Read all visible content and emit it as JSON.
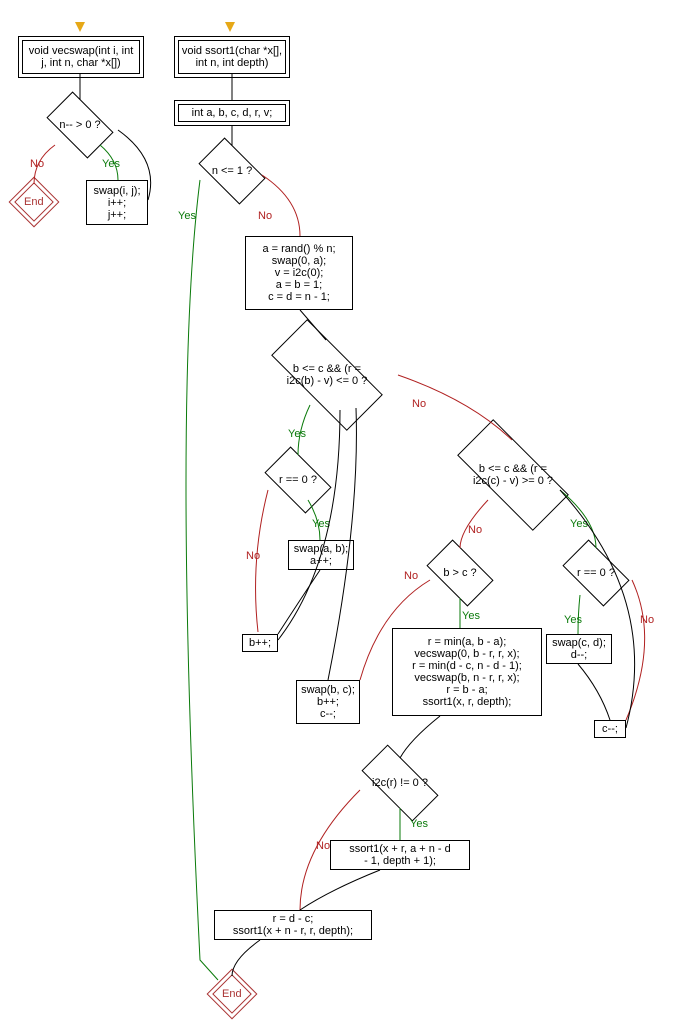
{
  "chart_data": {
    "type": "flowchart",
    "functions": [
      {
        "name": "vecswap",
        "signature": "void vecswap(int i, int j, int n, char *x[])",
        "entry": "vecswap-start",
        "nodes": [
          {
            "id": "vecswap-start",
            "kind": "start",
            "text": "void vecswap(int i, int\nj, int n, char *x[])"
          },
          {
            "id": "vec-cond",
            "kind": "decision",
            "text": "n-- > 0 ?"
          },
          {
            "id": "vec-body",
            "kind": "process",
            "text": "swap(i, j);\ni++;\nj++;"
          },
          {
            "id": "vec-end",
            "kind": "end",
            "text": "End"
          }
        ],
        "edges": [
          {
            "from": "vecswap-start",
            "to": "vec-cond"
          },
          {
            "from": "vec-cond",
            "to": "vec-body",
            "label": "Yes"
          },
          {
            "from": "vec-body",
            "to": "vec-cond",
            "back": true
          },
          {
            "from": "vec-cond",
            "to": "vec-end",
            "label": "No"
          }
        ]
      },
      {
        "name": "ssort1",
        "signature": "void ssort1(char *x[], int n, int depth)",
        "entry": "ssort1-start",
        "nodes": [
          {
            "id": "ssort1-start",
            "kind": "start",
            "text": "void ssort1(char *x[],\nint n, int depth)"
          },
          {
            "id": "decl",
            "kind": "process",
            "text": "int a, b, c, d, r, v;"
          },
          {
            "id": "n-le-1",
            "kind": "decision",
            "text": "n <= 1 ?"
          },
          {
            "id": "init",
            "kind": "process",
            "text": "a = rand() % n;\nswap(0, a);\nv = i2c(0);\na = b = 1;\nc = d = n - 1;"
          },
          {
            "id": "left-cond",
            "kind": "decision",
            "text": "b <= c && (r =\ni2c(b) - v) <= 0 ?"
          },
          {
            "id": "r-eq-0-l",
            "kind": "decision",
            "text": "r == 0 ?"
          },
          {
            "id": "swap-ab",
            "kind": "process",
            "text": "swap(a, b);\na++;"
          },
          {
            "id": "bpp",
            "kind": "process",
            "text": "b++;"
          },
          {
            "id": "right-cond",
            "kind": "decision",
            "text": "b <= c && (r =\ni2c(c) - v) >= 0 ?"
          },
          {
            "id": "r-eq-0-r",
            "kind": "decision",
            "text": "r == 0 ?"
          },
          {
            "id": "swap-cd",
            "kind": "process",
            "text": "swap(c, d);\nd--;"
          },
          {
            "id": "cmm",
            "kind": "process",
            "text": "c--;"
          },
          {
            "id": "b-gt-c",
            "kind": "decision",
            "text": "b > c ?"
          },
          {
            "id": "swap-bc",
            "kind": "process",
            "text": "swap(b, c);\nb++;\nc--;"
          },
          {
            "id": "recurse-prep",
            "kind": "process",
            "text": "r = min(a, b - a);\nvecswap(0, b - r, r, x);\nr = min(d - c, n - d - 1);\nvecswap(b, n - r, r, x);\nr = b - a;\nssort1(x, r, depth);"
          },
          {
            "id": "i2c-r",
            "kind": "decision",
            "text": "i2c(r) != 0 ?"
          },
          {
            "id": "recurse-mid",
            "kind": "process",
            "text": "ssort1(x + r, a + n - d\n- 1, depth + 1);"
          },
          {
            "id": "tail",
            "kind": "process",
            "text": "r = d - c;\nssort1(x + n - r, r, depth);"
          },
          {
            "id": "ssort1-end",
            "kind": "end",
            "text": "End"
          }
        ],
        "edges": [
          {
            "from": "ssort1-start",
            "to": "decl"
          },
          {
            "from": "decl",
            "to": "n-le-1"
          },
          {
            "from": "n-le-1",
            "to": "ssort1-end",
            "label": "Yes"
          },
          {
            "from": "n-le-1",
            "to": "init",
            "label": "No"
          },
          {
            "from": "init",
            "to": "left-cond"
          },
          {
            "from": "left-cond",
            "to": "r-eq-0-l",
            "label": "Yes"
          },
          {
            "from": "left-cond",
            "to": "right-cond",
            "label": "No"
          },
          {
            "from": "r-eq-0-l",
            "to": "swap-ab",
            "label": "Yes"
          },
          {
            "from": "r-eq-0-l",
            "to": "bpp",
            "label": "No"
          },
          {
            "from": "swap-ab",
            "to": "bpp"
          },
          {
            "from": "bpp",
            "to": "left-cond",
            "back": true
          },
          {
            "from": "right-cond",
            "to": "r-eq-0-r",
            "label": "Yes"
          },
          {
            "from": "right-cond",
            "to": "b-gt-c",
            "label": "No"
          },
          {
            "from": "r-eq-0-r",
            "to": "swap-cd",
            "label": "Yes"
          },
          {
            "from": "r-eq-0-r",
            "to": "cmm",
            "label": "No"
          },
          {
            "from": "swap-cd",
            "to": "cmm"
          },
          {
            "from": "cmm",
            "to": "right-cond",
            "back": true
          },
          {
            "from": "b-gt-c",
            "to": "recurse-prep",
            "label": "Yes"
          },
          {
            "from": "b-gt-c",
            "to": "swap-bc",
            "label": "No"
          },
          {
            "from": "swap-bc",
            "to": "left-cond",
            "back": true
          },
          {
            "from": "recurse-prep",
            "to": "i2c-r"
          },
          {
            "from": "i2c-r",
            "to": "recurse-mid",
            "label": "Yes"
          },
          {
            "from": "i2c-r",
            "to": "tail",
            "label": "No"
          },
          {
            "from": "recurse-mid",
            "to": "tail"
          },
          {
            "from": "tail",
            "to": "ssort1-end"
          }
        ]
      }
    ]
  },
  "labels": {
    "yes": "Yes",
    "no": "No",
    "end": "End"
  },
  "nodes": {
    "vecswap_start": "void vecswap(int i, int\nj, int n, char *x[])",
    "vec_cond": "n-- > 0 ?",
    "vec_body": "swap(i, j);\ni++;\nj++;",
    "ssort1_start": "void ssort1(char *x[],\nint n, int depth)",
    "decl": "int a, b, c, d, r, v;",
    "n_le_1": "n <= 1 ?",
    "init": "a = rand() % n;\nswap(0, a);\nv = i2c(0);\na = b = 1;\nc = d = n - 1;",
    "left_cond": "b <= c && (r =\ni2c(b) - v) <= 0 ?",
    "r_eq_0_l": "r == 0 ?",
    "swap_ab": "swap(a, b);\na++;",
    "bpp": "b++;",
    "right_cond": "b <= c && (r =\ni2c(c) - v) >= 0 ?",
    "r_eq_0_r": "r == 0 ?",
    "swap_cd": "swap(c, d);\nd--;",
    "cmm": "c--;",
    "b_gt_c": "b > c ?",
    "swap_bc": "swap(b, c);\nb++;\nc--;",
    "recurse_prep": "r = min(a, b - a);\nvecswap(0, b - r, r, x);\nr = min(d - c, n - d - 1);\nvecswap(b, n - r, r, x);\nr = b - a;\nssort1(x, r, depth);",
    "i2c_r": "i2c(r) != 0 ?",
    "recurse_mid": "ssort1(x + r, a + n - d\n- 1, depth + 1);",
    "tail": "r = d - c;\nssort1(x + n - r, r, depth);"
  }
}
